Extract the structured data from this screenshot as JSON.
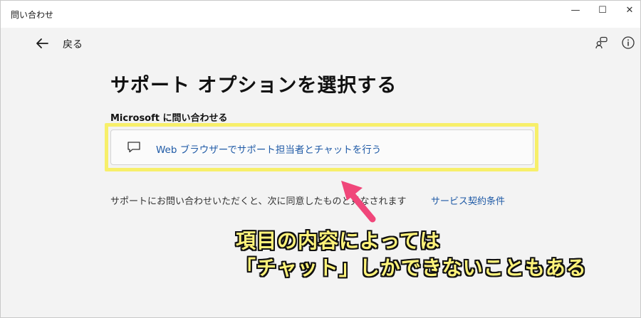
{
  "window": {
    "title": "問い合わせ",
    "minimize_glyph": "—",
    "maximize_glyph": "☐",
    "close_glyph": "✕"
  },
  "header": {
    "back_label": "戻る",
    "icons": [
      "back-arrow-icon",
      "community-icon",
      "info-icon"
    ]
  },
  "main": {
    "title": "サポート オプションを選択する",
    "section_label": "Microsoft に問い合わせる",
    "option": {
      "label": "Web ブラウザーでサポート担当者とチャットを行う",
      "icon": "chat-icon"
    },
    "agreement_text": "サポートにお問い合わせいただくと、次に同意したものと見なされます",
    "terms_link": "サービス契約条件"
  },
  "annotation": {
    "line1": "項目の内容によっては",
    "line2": "「チャット」しかできないこともある"
  },
  "colors": {
    "accent_link": "#1f5aa6",
    "highlight": "#f7ef6a",
    "arrow": "#f0467a",
    "annotation_text": "#fff37a"
  }
}
